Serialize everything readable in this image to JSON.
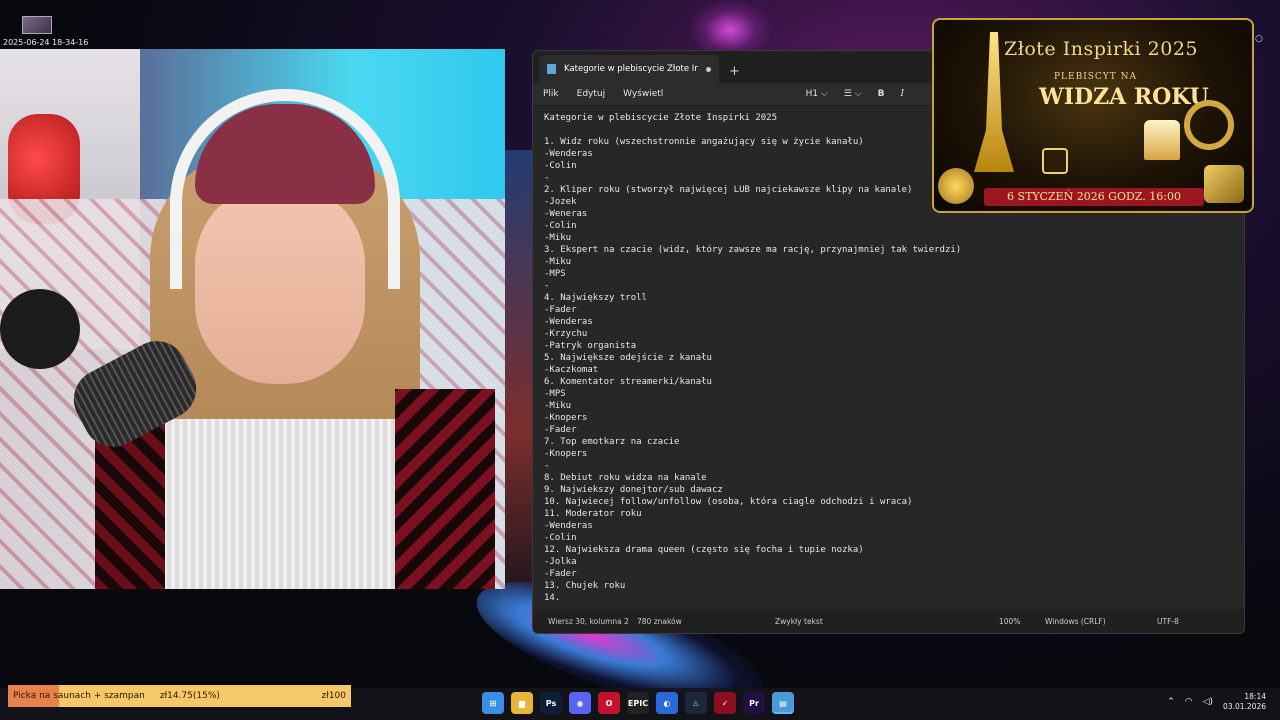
{
  "overlay": {
    "timestamp": "2025-06-24 18-34-16"
  },
  "notepad": {
    "tab_title": "Kategorie w plebiscycie Złote Inspi",
    "new_tab_symbol": "+",
    "menu": [
      "Plik",
      "Edytuj",
      "Wyświetl"
    ],
    "toolbar": {
      "heading": "H1 ⌵",
      "list": "☰ ⌵",
      "bold": "B",
      "italic": "I"
    },
    "lines": [
      "Kategorie w plebiscycie Złote Inspirki 2025",
      "",
      "1. Widz roku (wszechstronnie angażujący się w życie kanału)",
      "-Wenderas",
      "-Colin",
      "-",
      "2. Kliper roku (stworzył najwięcej LUB najciekawsze klipy na kanale)",
      "-Jozek",
      "-Weneras",
      "-Colin",
      "-Miku",
      "3. Ekspert na czacie (widz, który zawsze ma rację, przynajmniej tak twierdzi)",
      "-Miku",
      "-MPS",
      "-",
      "4. Największy troll",
      "-Fader",
      "-Wenderas",
      "-Krzychu",
      "-Patryk organista",
      "5. Największe odejście z kanału",
      "-Kaczkomat",
      "6. Komentator streamerki/kanału",
      "-MPS",
      "-Miku",
      "-Knopers",
      "-Fader",
      "7. Top emotkarz na czacie",
      "-Knopers",
      "-",
      "8. Debiut roku widza na kanale",
      "9. Najwiekszy donejtor/sub dawacz",
      "10. Najwiecej follow/unfollow (osoba, która ciagle odchodzi i wraca)",
      "11. Moderator roku",
      "-Wenderas",
      "-Colin",
      "12. Najwieksza drama queen (często się focha i tupie nozka)",
      "-Jolka",
      "-Fader",
      "13. Chujek roku",
      "14."
    ],
    "status": {
      "position": "Wiersz 30, kolumna 2",
      "chars": "780 znaków",
      "format": "Zwykły tekst",
      "zoom": "100%",
      "line_ending": "Windows (CRLF)",
      "encoding": "UTF-8"
    }
  },
  "promo": {
    "title": "Złote Inspirki 2025",
    "subtitle": "PLEBISCYT NA",
    "headline": "WIDZA ROKU",
    "date": "6 STYCZEŃ 2026   GODZ. 16:00"
  },
  "goal": {
    "label": "Picka na saunach + szampan",
    "amount": "zł14.75(15%)",
    "target": "zł100",
    "progress": 0.15
  },
  "taskbar": {
    "icons": [
      {
        "name": "start-icon",
        "glyph": "⊞",
        "color": "#3a8ee6"
      },
      {
        "name": "file-explorer-icon",
        "glyph": "▆",
        "color": "#e8b43a"
      },
      {
        "name": "photoshop-icon",
        "glyph": "Ps",
        "color": "#0e1e36"
      },
      {
        "name": "discord-icon",
        "glyph": "◉",
        "color": "#5865f2"
      },
      {
        "name": "opera-icon",
        "glyph": "O",
        "color": "#c4122e"
      },
      {
        "name": "epic-games-icon",
        "glyph": "EPIC",
        "color": "#222"
      },
      {
        "name": "browser-icon",
        "glyph": "◐",
        "color": "#2a6ad8"
      },
      {
        "name": "steam-icon",
        "glyph": "♨",
        "color": "#1b2838"
      },
      {
        "name": "app-red-icon",
        "glyph": "✓",
        "color": "#8a1020"
      },
      {
        "name": "premiere-icon",
        "glyph": "Pr",
        "color": "#1e1040"
      },
      {
        "name": "notepad-icon",
        "glyph": "▤",
        "color": "#4a9ad8"
      }
    ],
    "time": "18:14",
    "date": "03.01.2026"
  }
}
